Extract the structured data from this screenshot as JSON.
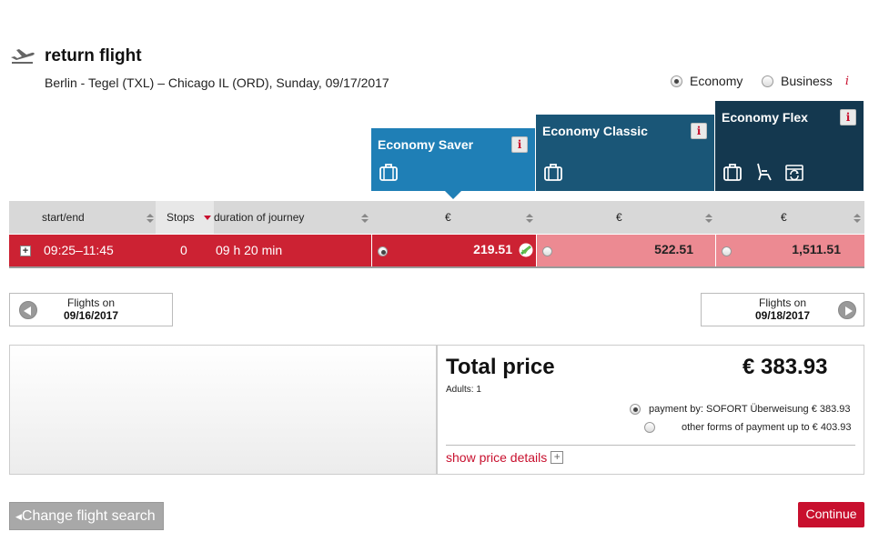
{
  "header": {
    "title": "return flight",
    "route": "Berlin - Tegel (TXL) – Chicago IL (ORD),  Sunday, 09/17/2017",
    "icon": "plane-departure-icon"
  },
  "cabin_selector": {
    "economy_label": "Economy",
    "business_label": "Business",
    "selected": "Economy",
    "info_symbol": "i"
  },
  "fares": [
    {
      "name": "Economy Saver",
      "color": "#1f7fb6",
      "info": "i",
      "icons": [
        "baggage-icon"
      ]
    },
    {
      "name": "Economy Classic",
      "color": "#1a5677",
      "info": "i",
      "icons": [
        "baggage-icon"
      ]
    },
    {
      "name": "Economy Flex",
      "color": "#14384f",
      "info": "i",
      "icons": [
        "baggage-icon",
        "seat-icon",
        "rebooking-icon"
      ]
    }
  ],
  "table": {
    "headers": {
      "start_end": "start/end",
      "stops": "Stops",
      "duration": "duration of journey",
      "currency_1": "€",
      "currency_2": "€",
      "currency_3": "€"
    },
    "rows": [
      {
        "times": "09:25–11:45",
        "stops": "0",
        "duration": "09 h 20 min",
        "prices": [
          "219.51",
          "522.51",
          "1,511.51"
        ],
        "selected_fare": "Economy Saver"
      }
    ]
  },
  "navigation": {
    "prev_label": "Flights on",
    "prev_date": "09/16/2017",
    "next_label": "Flights on",
    "next_date": "09/18/2017"
  },
  "summary": {
    "total_label": "Total price",
    "total_value": "€ 383.93",
    "adults": "Adults: 1",
    "payment_options": [
      {
        "label": "payment by: SOFORT Überweisung € 383.93",
        "selected": true
      },
      {
        "label": "other forms of payment up to € 403.93",
        "selected": false
      }
    ],
    "details_link": "show price details",
    "details_symbol": "+"
  },
  "buttons": {
    "change_search": "Change flight search",
    "continue": "Continue"
  },
  "colors": {
    "brand_red": "#c8102e",
    "selected_row": "#cc2233",
    "unselected_price": "#ec8a92"
  }
}
